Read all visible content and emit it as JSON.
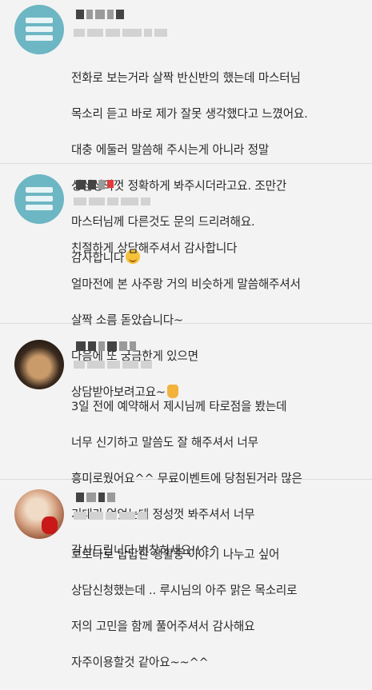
{
  "reviews": [
    {
      "avatar": "teal-robot-avatar",
      "lines": [
        "전화로 보는거라 살짝 반신반의 했는데 마스터님",
        "목소리 듣고 바로 제가 잘못 생각했다고 느꼈어요.",
        "대충 에둘러 말씀해 주시는게 아니라 정말",
        "성심성의껏 정확하게 봐주시더라고요. 조만간",
        "마스터님께 다른것도 문의 드리려해요.",
        "감사합니다"
      ],
      "emoji": "smiling-face-icon"
    },
    {
      "avatar": "teal-robot-avatar",
      "lines": [
        "친절하게 상담해주셔서 감사합니다",
        "얼마전에 본 사주랑 거의 비슷하게 말씀해주셔서",
        "살짝 소름 돋았습니다~",
        "다음에 또 궁금한게 있으면",
        "상담받아보려고요~"
      ],
      "emoji": "thumbs-up-icon"
    },
    {
      "avatar": "photo-avatar-dark",
      "lines": [
        "3일 전에 예약해서 제시님께 타로점을 봤는데",
        "너무 신기하고 말씀도 잘 해주셔서 너무",
        "흥미로웠어요^^ 무료이벤트에 당첨된거라 많은",
        "기대가 없었는데 정성껏 봐주셔서 너무",
        "감사드립니다 번창하세요!!^^"
      ]
    },
    {
      "avatar": "photo-avatar-warm",
      "lines": [
        "코로나로 답답한 생활중 이야기 나누고 싶어",
        "상담신청했는데 .. 루시님의 아주 맑은 목소리로",
        "저의 고민을 함께 풀어주셔서 감사해요",
        "자주이용할것 같아요~~^^"
      ]
    }
  ]
}
